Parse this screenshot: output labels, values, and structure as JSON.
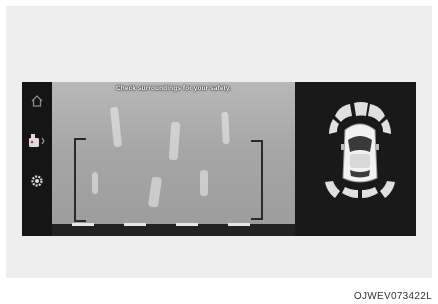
{
  "camera_view": {
    "warning_text": "Check surroundings for your safety."
  },
  "sidebar": {
    "items": [
      {
        "icon": "home-icon"
      },
      {
        "icon": "parking-view-icon"
      },
      {
        "icon": "settings-gear-icon"
      }
    ]
  },
  "sensor_display": {
    "front_sensor_zones": 4,
    "side_sensor_zones": 4
  },
  "figure_code": "OJWEV073422L",
  "colors": {
    "screen_bg": "#1e1e1e",
    "sensor_zone": "#e0e0e0",
    "car_body": "#f2f2f2"
  }
}
